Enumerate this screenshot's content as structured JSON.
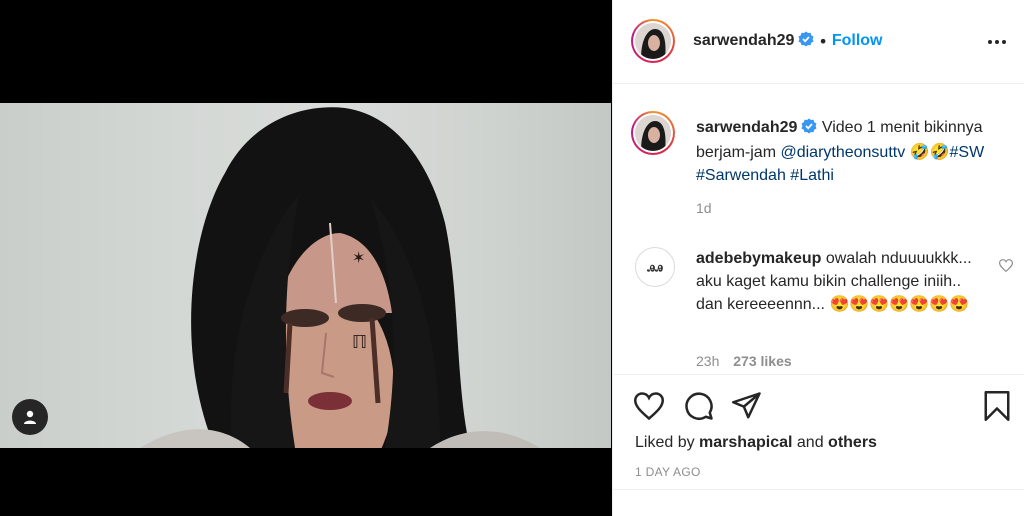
{
  "media": {
    "user_tag_icon": "person-icon"
  },
  "post": {
    "username": "sarwendah29",
    "verified_icon": "verified-badge-icon",
    "dot": "•",
    "follow_label": "Follow",
    "more_icon": "more-horizontal-icon"
  },
  "caption": {
    "username": "sarwendah29",
    "text_1": "Video 1 menit bikinnya berjam-jam",
    "mention": "@diarytheonsuttv",
    "emoji": "🤣🤣",
    "tag_sw": "#SW",
    "tag_sarwendah": "#Sarwendah",
    "tag_lathi": "#Lathi",
    "age": "1d"
  },
  "comment": {
    "username": "adebebymakeup",
    "avatar_text": "ꭿꭿ",
    "text": "owalah nduuuukkk... aku kaget kamu bikin challenge iniih.. dan kereeeennn...",
    "emoji": "😍😍😍😍😍😍😍",
    "age": "23h",
    "likes": "273 likes"
  },
  "actions": {
    "like_icon": "heart-icon",
    "comment_icon": "comment-icon",
    "share_icon": "send-icon",
    "save_icon": "bookmark-icon"
  },
  "likes": {
    "prefix": "Liked by",
    "user": "marshapical",
    "and": "and",
    "others": "others"
  },
  "timestamp": "1 DAY AGO",
  "colors": {
    "accent": "#0095f6",
    "link": "#00376b",
    "text": "#262626",
    "muted": "#8e8e8e",
    "border": "#efefef"
  }
}
